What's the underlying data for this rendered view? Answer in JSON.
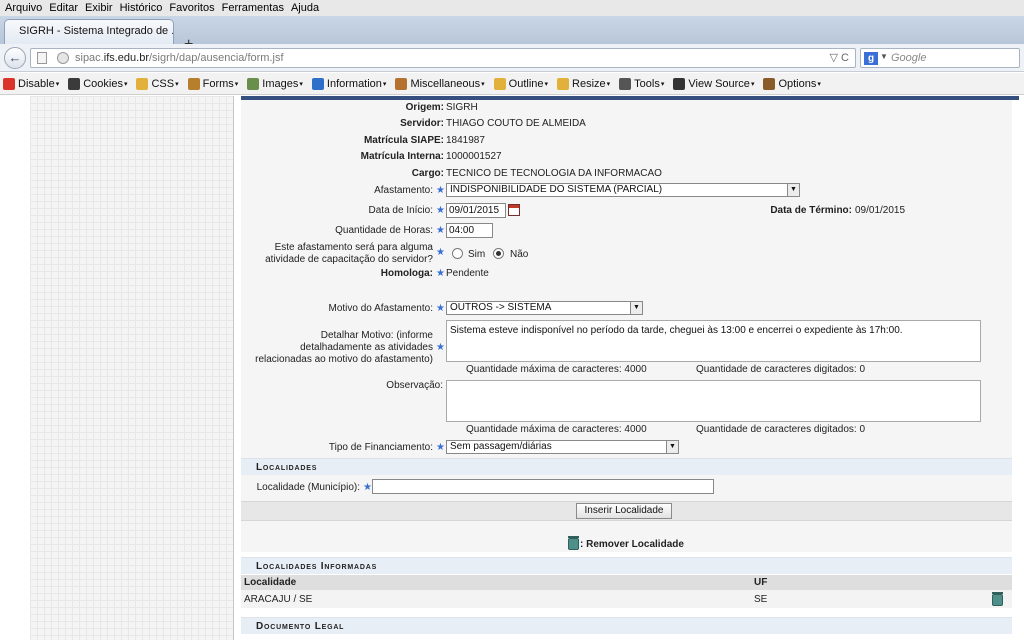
{
  "browser": {
    "menu": [
      "Arquivo",
      "Editar",
      "Exibir",
      "Histórico",
      "Favoritos",
      "Ferramentas",
      "Ajuda"
    ],
    "tab_title": "SIGRH - Sistema Integrado de ...",
    "new_tab": "+",
    "url_prefix": "sipac.",
    "url_domain": "ifs.edu.br",
    "url_path": "/sigrh/dap/ausencia/form.jsf",
    "url_controls": "▽ C",
    "search_engine": "g",
    "search_placeholder": "Google",
    "toolbar": [
      {
        "label": "Disable",
        "icon": "disable-icon",
        "color": "#d9332b"
      },
      {
        "label": "Cookies",
        "icon": "cookies-icon",
        "color": "#3b3b3b"
      },
      {
        "label": "CSS",
        "icon": "css-icon",
        "color": "#e2b13c"
      },
      {
        "label": "Forms",
        "icon": "forms-icon",
        "color": "#b77f2c"
      },
      {
        "label": "Images",
        "icon": "images-icon",
        "color": "#6a8f4a"
      },
      {
        "label": "Information",
        "icon": "information-icon",
        "color": "#2d6fc9"
      },
      {
        "label": "Miscellaneous",
        "icon": "miscellaneous-icon",
        "color": "#b5722e"
      },
      {
        "label": "Outline",
        "icon": "outline-icon",
        "color": "#e2b13c"
      },
      {
        "label": "Resize",
        "icon": "resize-icon",
        "color": "#e2b13c"
      },
      {
        "label": "Tools",
        "icon": "tools-icon",
        "color": "#555555"
      },
      {
        "label": "View Source",
        "icon": "view-source-icon",
        "color": "#333333"
      },
      {
        "label": "Options",
        "icon": "options-icon",
        "color": "#8a5a2b"
      }
    ]
  },
  "form": {
    "origem": {
      "label": "Origem:",
      "value": "SIGRH"
    },
    "servidor": {
      "label": "Servidor:",
      "value": "THIAGO COUTO DE ALMEIDA"
    },
    "matricula_siape": {
      "label": "Matrícula SIAPE:",
      "value": "1841987"
    },
    "matricula_interna": {
      "label": "Matrícula Interna:",
      "value": "1000001527"
    },
    "cargo": {
      "label": "Cargo:",
      "value": "TECNICO DE TECNOLOGIA DA INFORMACAO"
    },
    "afastamento": {
      "label": "Afastamento:",
      "value": "INDISPONIBILIDADE DO SISTEMA (PARCIAL)"
    },
    "data_inicio": {
      "label": "Data de Início:",
      "value": "09/01/2015"
    },
    "data_termino": {
      "label": "Data de Término:",
      "value": "09/01/2015"
    },
    "quantidade_horas": {
      "label": "Quantidade de Horas:",
      "value": "04:00"
    },
    "capacitacao": {
      "label_line1": "Este afastamento será para alguma",
      "label_line2": "atividade de capacitação do servidor?",
      "option_sim": "Sim",
      "option_nao": "Não",
      "selected": "Não"
    },
    "homologa": {
      "label": "Homologa:",
      "value": "Pendente"
    },
    "motivo": {
      "label": "Motivo do Afastamento:",
      "value": "OUTROS -> SISTEMA"
    },
    "detalhar": {
      "label_line1": "Detalhar Motivo: (informe",
      "label_line2": "detalhadamente as atividades",
      "label_line3": "relacionadas ao motivo do afastamento)",
      "value": "Sistema esteve indisponível no período da tarde, cheguei às 13:00 e encerrei o expediente às 17h:00.",
      "max_chars": "Quantidade máxima de caracteres: 4000",
      "typed_chars": "Quantidade de caracteres digitados: 0"
    },
    "observacao": {
      "label": "Observação:",
      "value": "",
      "max_chars": "Quantidade máxima de caracteres: 4000",
      "typed_chars": "Quantidade de caracteres digitados: 0"
    },
    "financiamento": {
      "label": "Tipo de Financiamento:",
      "value": "Sem passagem/diárias"
    }
  },
  "localidades": {
    "section_title": "Localidades",
    "municipio_label": "Localidade (Município):",
    "municipio_value": "",
    "inserir_button": "Inserir Localidade",
    "remover_legend": ": Remover Localidade"
  },
  "informadas": {
    "section_title": "Localidades Informadas",
    "col_localidade": "Localidade",
    "col_uf": "UF",
    "rows": [
      {
        "localidade": "ARACAJU / SE",
        "uf": "SE"
      }
    ]
  },
  "documento": {
    "section_title": "Documento Legal"
  },
  "colors": {
    "accent_bar": "#35507f",
    "section_bg": "#e8eef6",
    "required_star": "#3a6fd4"
  }
}
